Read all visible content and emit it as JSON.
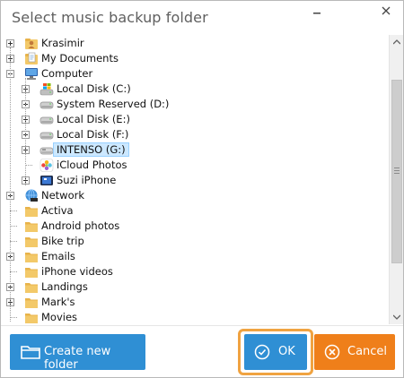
{
  "dialog": {
    "title": "Select music backup folder",
    "tree": [
      {
        "label": "Krasimir",
        "icon": "user-folder-icon",
        "expander": "plus",
        "level": 0
      },
      {
        "label": "My Documents",
        "icon": "documents-folder-icon",
        "expander": "plus",
        "level": 0
      },
      {
        "label": "Computer",
        "icon": "computer-icon",
        "expander": "minus",
        "level": 0
      },
      {
        "label": "Local Disk (C:)",
        "icon": "windows-drive-icon",
        "expander": "plus",
        "level": 1
      },
      {
        "label": "System Reserved (D:)",
        "icon": "drive-icon",
        "expander": "plus",
        "level": 1
      },
      {
        "label": "Local Disk (E:)",
        "icon": "drive-icon",
        "expander": "plus",
        "level": 1
      },
      {
        "label": "Local Disk (F:)",
        "icon": "drive-icon",
        "expander": "plus",
        "level": 1
      },
      {
        "label": "INTENSO (G:)",
        "icon": "usb-drive-icon",
        "expander": "plus",
        "level": 1,
        "selected": true
      },
      {
        "label": "iCloud Photos",
        "icon": "icloud-photos-icon",
        "expander": "none",
        "level": 1
      },
      {
        "label": "Suzi iPhone",
        "icon": "iphone-icon",
        "expander": "plus",
        "level": 1
      },
      {
        "label": "Network",
        "icon": "network-icon",
        "expander": "plus",
        "level": 0
      },
      {
        "label": "Activa",
        "icon": "folder-icon",
        "expander": "none",
        "level": 0
      },
      {
        "label": "Android photos",
        "icon": "folder-icon",
        "expander": "none",
        "level": 0
      },
      {
        "label": "Bike trip",
        "icon": "folder-icon",
        "expander": "none",
        "level": 0
      },
      {
        "label": "Emails",
        "icon": "folder-icon",
        "expander": "plus",
        "level": 0
      },
      {
        "label": "iPhone videos",
        "icon": "folder-icon",
        "expander": "none",
        "level": 0
      },
      {
        "label": "Landings",
        "icon": "folder-icon",
        "expander": "plus",
        "level": 0
      },
      {
        "label": "Mark's",
        "icon": "folder-icon",
        "expander": "plus",
        "level": 0
      },
      {
        "label": "Movies",
        "icon": "folder-icon",
        "expander": "none",
        "level": 0
      }
    ],
    "buttons": {
      "create_new_folder": "Create new folder",
      "ok": "OK",
      "cancel": "Cancel"
    },
    "colors": {
      "button_blue": "#2f8fd4",
      "button_orange": "#ef7f1a",
      "focus_ring": "#f0a341",
      "selection": "#cce8ff"
    }
  }
}
